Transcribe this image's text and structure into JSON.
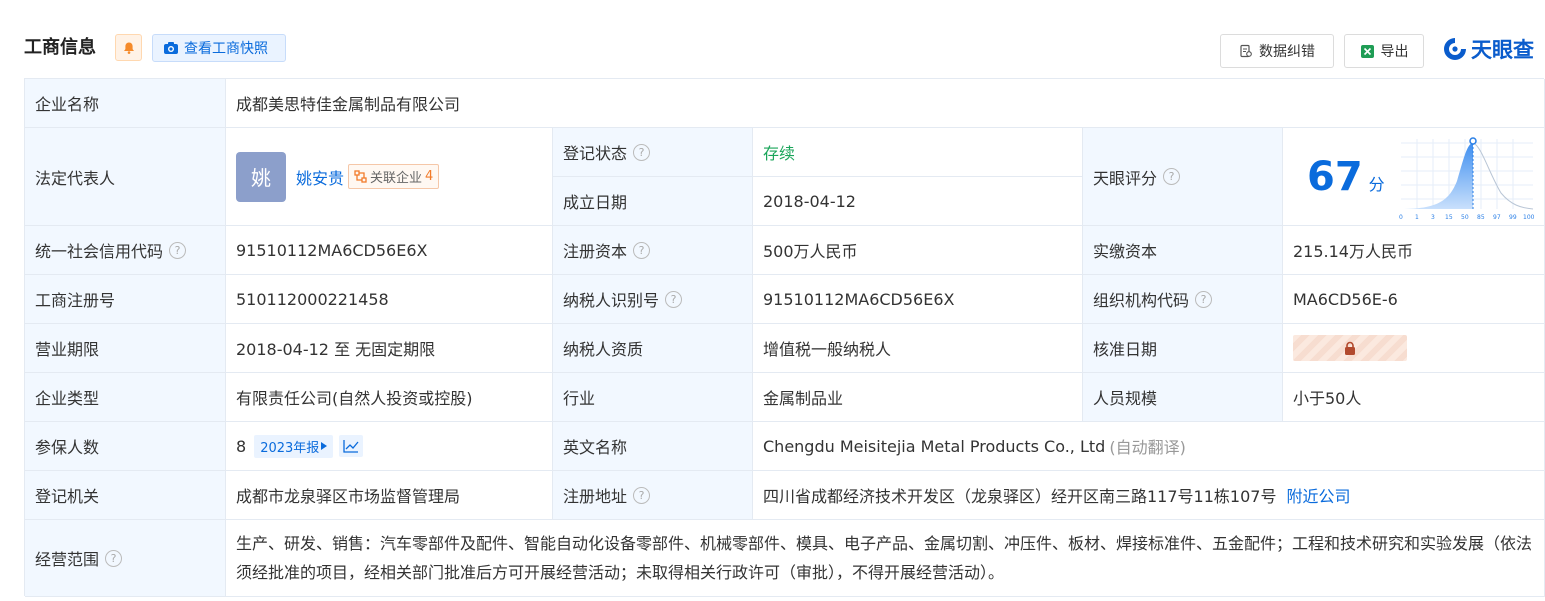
{
  "header": {
    "title": "工商信息",
    "snapshot_label": "查看工商快照",
    "correction_label": "数据纠错",
    "export_label": "导出",
    "logo_text": "天眼查"
  },
  "fields": {
    "company_name": {
      "label": "企业名称",
      "value": "成都美思特佳金属制品有限公司"
    },
    "legal_rep": {
      "label": "法定代表人",
      "avatar": "姚",
      "name": "姚安贵",
      "related_label": "关联企业",
      "related_count": "4"
    },
    "reg_status": {
      "label": "登记状态",
      "value": "存续"
    },
    "founded": {
      "label": "成立日期",
      "value": "2018-04-12"
    },
    "tianyan_score": {
      "label": "天眼评分",
      "score": "67",
      "unit": "分",
      "ticks": [
        "0",
        "1",
        "3",
        "15",
        "50",
        "85",
        "97",
        "99",
        "100"
      ]
    },
    "credit_code": {
      "label": "统一社会信用代码",
      "value": "91510112MA6CD56E6X"
    },
    "reg_capital": {
      "label": "注册资本",
      "value": "500万人民币"
    },
    "paid_capital": {
      "label": "实缴资本",
      "value": "215.14万人民币"
    },
    "reg_number": {
      "label": "工商注册号",
      "value": "510112000221458"
    },
    "taxpayer_id": {
      "label": "纳税人识别号",
      "value": "91510112MA6CD56E6X"
    },
    "org_code": {
      "label": "组织机构代码",
      "value": "MA6CD56E-6"
    },
    "business_term": {
      "label": "营业期限",
      "value": "2018-04-12 至 无固定期限"
    },
    "taxpayer_qual": {
      "label": "纳税人资质",
      "value": "增值税一般纳税人"
    },
    "approval_date": {
      "label": "核准日期"
    },
    "company_type": {
      "label": "企业类型",
      "value": "有限责任公司(自然人投资或控股)"
    },
    "industry": {
      "label": "行业",
      "value": "金属制品业"
    },
    "staff_size": {
      "label": "人员规模",
      "value": "小于50人"
    },
    "insured": {
      "label": "参保人数",
      "value": "8",
      "year_label": "2023年报"
    },
    "english_name": {
      "label": "英文名称",
      "value": "Chengdu Meisitejia Metal Products Co., Ltd",
      "auto": "(自动翻译)"
    },
    "reg_authority": {
      "label": "登记机关",
      "value": "成都市龙泉驿区市场监督管理局"
    },
    "reg_address": {
      "label": "注册地址",
      "value": "四川省成都经济技术开发区（龙泉驿区）经开区南三路117号11栋107号",
      "nearby": "附近公司"
    },
    "scope": {
      "label": "经营范围",
      "value": "生产、研发、销售：汽车零部件及配件、智能自动化设备零部件、机械零部件、模具、电子产品、金属切割、冲压件、板材、焊接标准件、五金配件；工程和技术研究和实验发展（依法须经批准的项目，经相关部门批准后方可开展经营活动；未取得相关行政许可（审批），不得开展经营活动）。"
    }
  },
  "colors": {
    "label_bg": "#f2f8ff",
    "border": "#e4eaf2",
    "accent": "#0a6bdc",
    "status": "#1aa55a"
  }
}
